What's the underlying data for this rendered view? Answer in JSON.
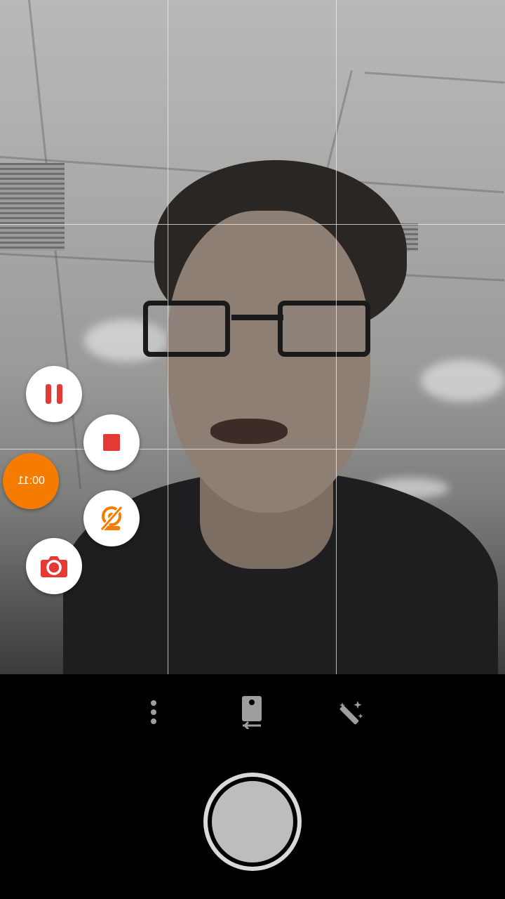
{
  "recording": {
    "timer_text": "00:11"
  },
  "controls": {
    "pause_icon": "pause-icon",
    "stop_icon": "stop-icon",
    "stabilization_off_icon": "stabilization-off-icon",
    "snapshot_icon": "camera-icon"
  },
  "toolbar": {
    "more_icon": "more-vertical-icon",
    "switch_camera_icon": "switch-camera-icon",
    "effects_icon": "magic-wand-icon"
  },
  "colors": {
    "accent": "#f57c00",
    "record_red": "#e53935",
    "toolbar_icon": "#9e9e9e"
  }
}
